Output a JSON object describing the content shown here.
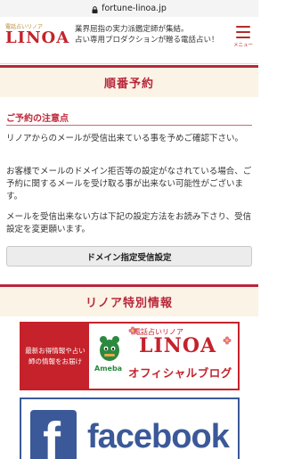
{
  "browser": {
    "url": "fortune-linoa.jp"
  },
  "header": {
    "logo_sub": "電話占いリノア",
    "logo_main": "LINOA",
    "tagline_1": "業界屈指の実力派鑑定師が集結。",
    "tagline_2": "占い専用プロダクションが贈る電話占い！",
    "menu_label": "メニュー"
  },
  "reservation": {
    "heading": "順番予約",
    "note_title": "ご予約の注意点",
    "para_1": "リノアからのメールが受信出来ている事を予めご確認下さい。",
    "para_2": "お客様でメールのドメイン拒否等の設定がなされている場合、ご予約に関するメールを受け取る事が出来ない可能性がございます。",
    "para_3": "メールを受信出来ない方は下記の設定方法をお読み下さり、受信設定を変更願います。",
    "domain_button": "ドメイン指定受信設定"
  },
  "special": {
    "heading": "リノア特別情報",
    "blog_left": "最新お得情報や占い師の情報をお届け",
    "ameba": "Ameba",
    "blog_sub": "電話占いリノア",
    "blog_logo": "LINOA",
    "blog_title": "オフィシャルブログ",
    "facebook": "facebook"
  },
  "colors": {
    "brand_red": "#c5222b",
    "section_bg": "#fbf3e6",
    "facebook_blue": "#3b5998"
  }
}
